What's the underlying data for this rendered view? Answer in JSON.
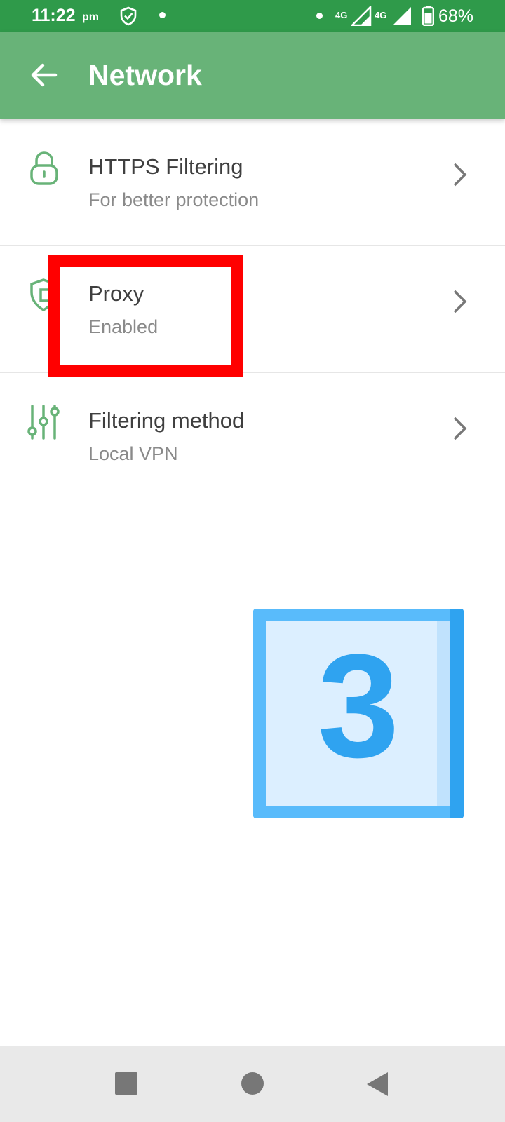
{
  "status_bar": {
    "time": "11:22",
    "time_suffix": "pm",
    "network_1": "4G",
    "network_2": "4G",
    "battery": "68%"
  },
  "app_bar": {
    "title": "Network",
    "back_icon": "arrow-back-icon"
  },
  "items": [
    {
      "title": "HTTPS Filtering",
      "subtitle": "For better protection",
      "icon": "lock-icon"
    },
    {
      "title": "Proxy",
      "subtitle": "Enabled",
      "icon": "shield-proxy-icon"
    },
    {
      "title": "Filtering method",
      "subtitle": "Local VPN",
      "icon": "sliders-icon"
    }
  ],
  "step_badge": {
    "number": "3"
  },
  "colors": {
    "status_bar": "#2f9a4a",
    "app_bar": "#68b378",
    "icon_green": "#68b378",
    "highlight": "#ff0000",
    "badge_blue": "#2fa3f0"
  },
  "nav_bar": {
    "icons": [
      "square-recents-icon",
      "circle-home-icon",
      "triangle-back-icon"
    ]
  }
}
